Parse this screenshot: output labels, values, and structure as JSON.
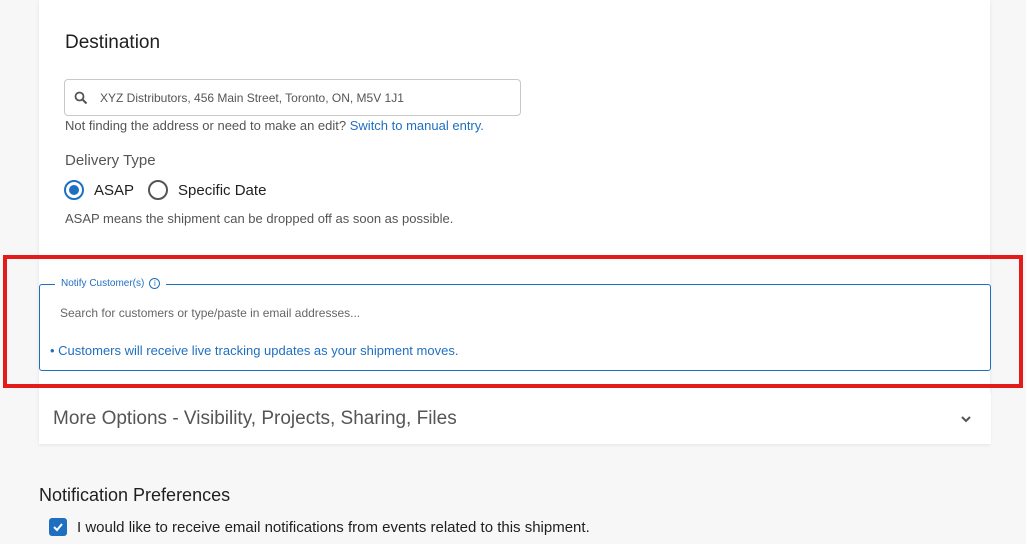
{
  "destination": {
    "title": "Destination",
    "search_value": "XYZ Distributors, 456 Main Street, Toronto, ON, M5V 1J1",
    "search_icon": "search-icon",
    "hint_text": "Not finding the address or need to make an edit? ",
    "hint_link": "Switch to manual entry."
  },
  "delivery": {
    "label": "Delivery Type",
    "options": [
      {
        "label": "ASAP",
        "checked": true
      },
      {
        "label": "Specific Date",
        "checked": false
      }
    ],
    "description": "ASAP means the shipment can be dropped off as soon as possible."
  },
  "notify": {
    "legend": "Notify Customer(s)",
    "info_icon": "info-icon",
    "placeholder": "Search for customers or type/paste in email addresses...",
    "note": "• Customers will receive live tracking updates as your shipment moves."
  },
  "more_options": {
    "label": "More Options - Visibility, Projects, Sharing, Files",
    "chevron_icon": "chevron-down-icon"
  },
  "notification_prefs": {
    "title": "Notification Preferences",
    "email_label": "I would like to receive email notifications from events related to this shipment.",
    "email_checked": true
  },
  "colors": {
    "accent": "#1f6fc1",
    "highlight": "#e41b1b"
  }
}
